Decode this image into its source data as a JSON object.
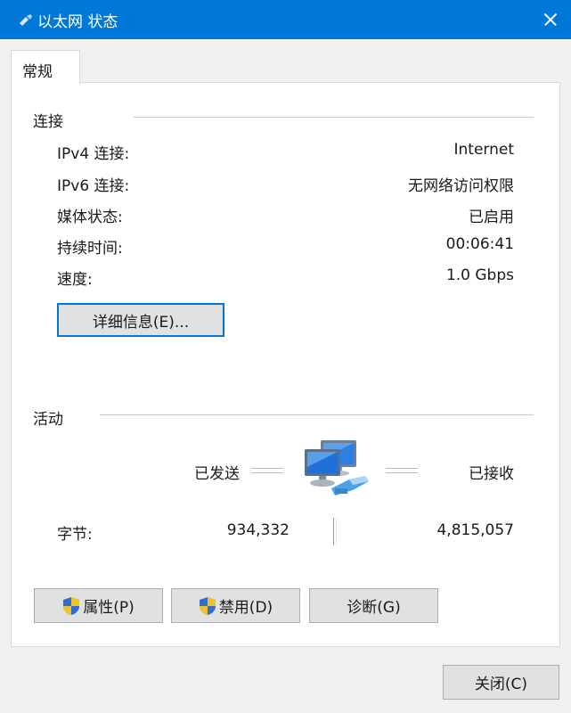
{
  "window": {
    "title": "以太网 状态",
    "close_icon": "close-icon"
  },
  "tabs": [
    {
      "label": "常规"
    }
  ],
  "connection": {
    "heading": "连接",
    "rows": [
      {
        "label": "IPv4 连接:",
        "value": "Internet"
      },
      {
        "label": "IPv6 连接:",
        "value": "无网络访问权限"
      },
      {
        "label": "媒体状态:",
        "value": "已启用"
      },
      {
        "label": "持续时间:",
        "value": "00:06:41"
      },
      {
        "label": "速度:",
        "value": "1.0 Gbps"
      }
    ],
    "details_button": "详细信息(E)..."
  },
  "activity": {
    "heading": "活动",
    "sent_label": "已发送",
    "received_label": "已接收",
    "bytes_label": "字节:",
    "bytes_sent": "934,332",
    "bytes_received": "4,815,057",
    "icon": "network-computers-icon"
  },
  "buttons": {
    "properties": "属性(P)",
    "disable": "禁用(D)",
    "diagnose": "诊断(G)",
    "close": "关闭(C)"
  },
  "colors": {
    "title_bar": "#0078d7",
    "focus_border": "#0078d7"
  }
}
